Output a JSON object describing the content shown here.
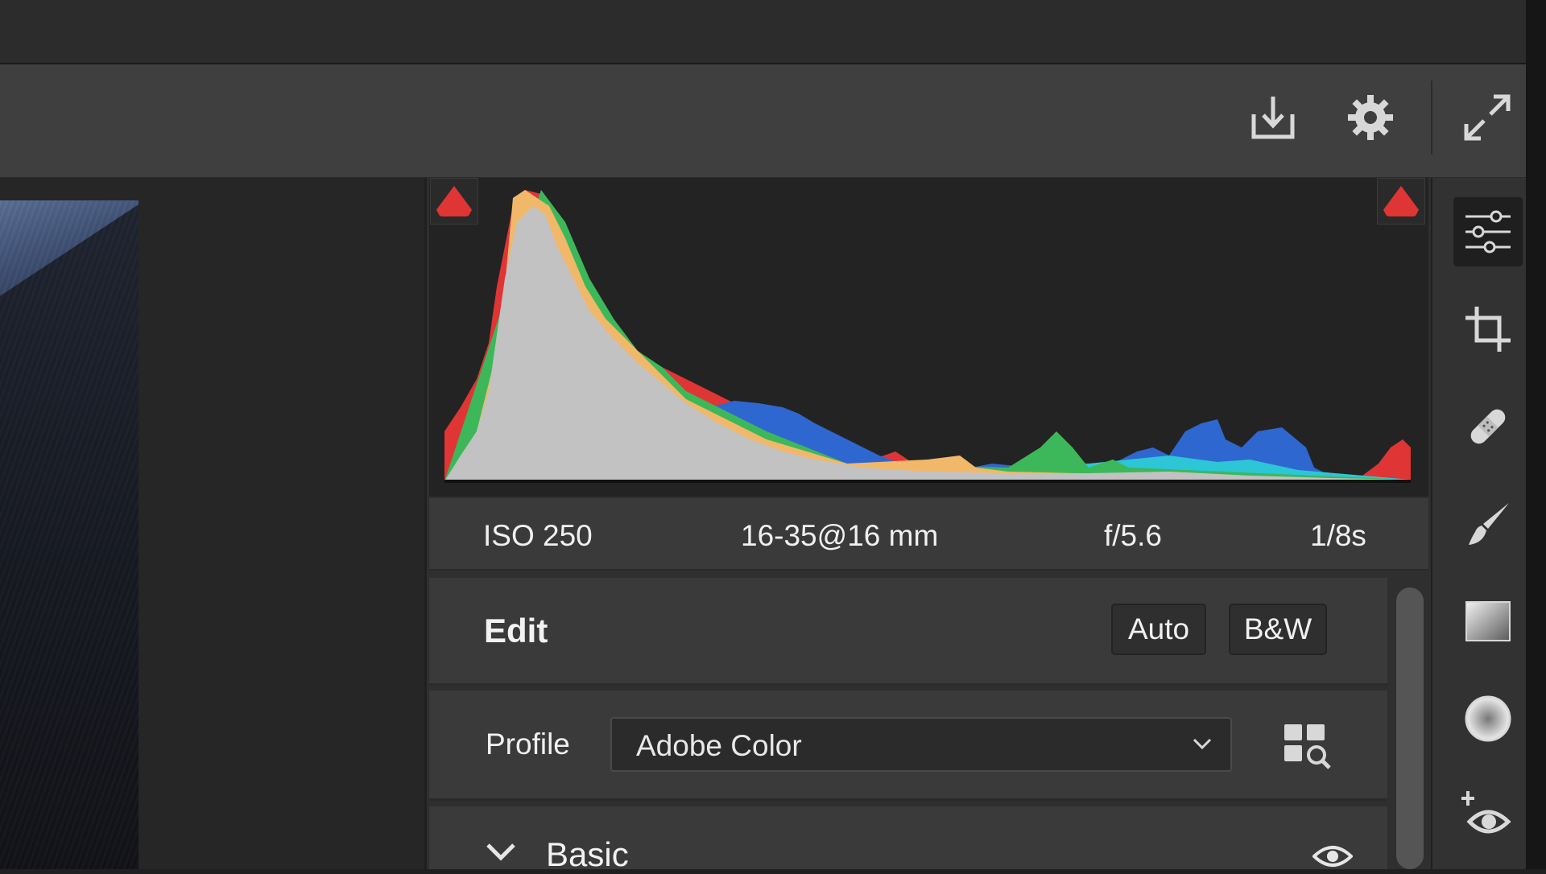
{
  "toolbar": {
    "icons": [
      "download-icon",
      "gear-icon",
      "expand-icon"
    ]
  },
  "histogram": {
    "shadow_clip_icon": "triangle-warning",
    "highlight_clip_icon": "triangle-warning",
    "clip_color": "#e03535"
  },
  "exif": {
    "iso": "ISO 250",
    "lens": "16-35@16 mm",
    "aperture": "f/5.6",
    "shutter": "1/8s"
  },
  "edit": {
    "title": "Edit",
    "auto_label": "Auto",
    "bw_label": "B&W"
  },
  "profile": {
    "label": "Profile",
    "value": "Adobe Color"
  },
  "basic": {
    "title": "Basic"
  },
  "tool_rail": {
    "active": "edit",
    "tools": [
      "sliders-icon",
      "crop-icon",
      "healing-icon",
      "brush-icon",
      "linear-gradient-icon",
      "radial-gradient-icon",
      "redeye-icon"
    ]
  }
}
